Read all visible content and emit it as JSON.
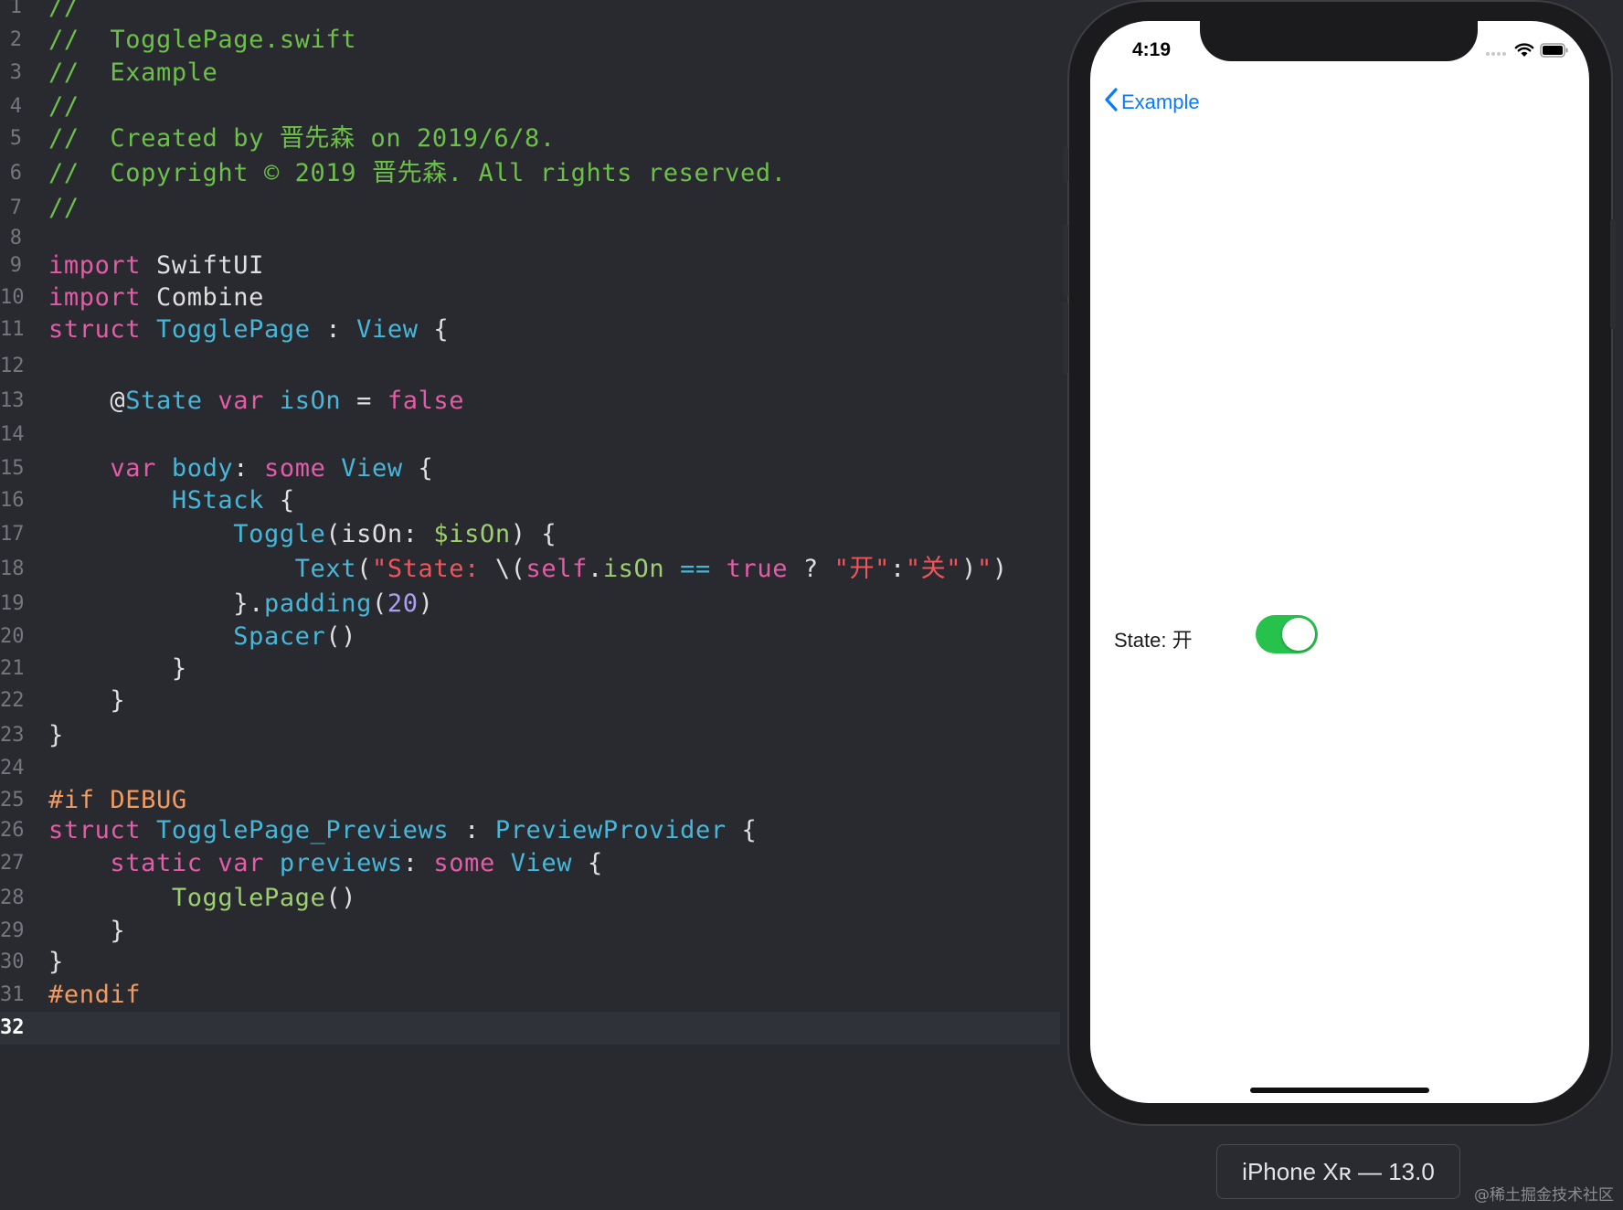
{
  "editor": {
    "current_line": 32,
    "lines": [
      {
        "n": "1",
        "tokens": [
          {
            "t": "//",
            "c": "com"
          }
        ]
      },
      {
        "n": "2",
        "tokens": [
          {
            "t": "//  TogglePage.swift",
            "c": "com"
          }
        ]
      },
      {
        "n": "3",
        "tokens": [
          {
            "t": "//  Example",
            "c": "com"
          }
        ]
      },
      {
        "n": "4",
        "tokens": [
          {
            "t": "//",
            "c": "com"
          }
        ]
      },
      {
        "n": "5",
        "tokens": [
          {
            "t": "//  Created by 晋先森 on 2019/6/8.",
            "c": "com"
          }
        ]
      },
      {
        "n": "6",
        "tokens": [
          {
            "t": "//  Copyright © 2019 晋先森. All rights reserved.",
            "c": "com"
          }
        ]
      },
      {
        "n": "7",
        "tokens": [
          {
            "t": "//",
            "c": "com"
          }
        ]
      },
      {
        "n": "8",
        "tokens": []
      },
      {
        "n": "9",
        "tokens": [
          {
            "t": "import",
            "c": "kw"
          },
          {
            "t": " SwiftUI",
            "c": "pl"
          }
        ]
      },
      {
        "n": "10",
        "tokens": [
          {
            "t": "import",
            "c": "kw"
          },
          {
            "t": " Combine",
            "c": "pl"
          }
        ]
      },
      {
        "n": "11",
        "tokens": [
          {
            "t": "struct",
            "c": "kw"
          },
          {
            "t": " ",
            "c": "pl"
          },
          {
            "t": "TogglePage",
            "c": "type"
          },
          {
            "t": " : ",
            "c": "pl"
          },
          {
            "t": "View",
            "c": "type"
          },
          {
            "t": " {",
            "c": "pl"
          }
        ]
      },
      {
        "n": "12",
        "tokens": []
      },
      {
        "n": "13",
        "tokens": [
          {
            "t": "    @",
            "c": "pl"
          },
          {
            "t": "State",
            "c": "type"
          },
          {
            "t": " ",
            "c": "pl"
          },
          {
            "t": "var",
            "c": "kw"
          },
          {
            "t": " isOn",
            "c": "type"
          },
          {
            "t": " = ",
            "c": "pl"
          },
          {
            "t": "false",
            "c": "kw"
          }
        ]
      },
      {
        "n": "14",
        "tokens": []
      },
      {
        "n": "15",
        "tokens": [
          {
            "t": "    ",
            "c": "pl"
          },
          {
            "t": "var",
            "c": "kw"
          },
          {
            "t": " body",
            "c": "type"
          },
          {
            "t": ": ",
            "c": "pl"
          },
          {
            "t": "some",
            "c": "kw"
          },
          {
            "t": " ",
            "c": "pl"
          },
          {
            "t": "View",
            "c": "type"
          },
          {
            "t": " {",
            "c": "pl"
          }
        ]
      },
      {
        "n": "16",
        "tokens": [
          {
            "t": "        ",
            "c": "pl"
          },
          {
            "t": "HStack",
            "c": "type"
          },
          {
            "t": " {",
            "c": "pl"
          }
        ]
      },
      {
        "n": "17",
        "tokens": [
          {
            "t": "            ",
            "c": "pl"
          },
          {
            "t": "Toggle",
            "c": "type"
          },
          {
            "t": "(isOn: ",
            "c": "pl"
          },
          {
            "t": "$isOn",
            "c": "pr"
          },
          {
            "t": ") {",
            "c": "pl"
          }
        ]
      },
      {
        "n": "18",
        "tokens": [
          {
            "t": "                ",
            "c": "pl"
          },
          {
            "t": "Text",
            "c": "type"
          },
          {
            "t": "(",
            "c": "pl"
          },
          {
            "t": "\"State: ",
            "c": "str"
          },
          {
            "t": "\\(",
            "c": "pl"
          },
          {
            "t": "self",
            "c": "kw"
          },
          {
            "t": ".",
            "c": "pl"
          },
          {
            "t": "isOn",
            "c": "pr"
          },
          {
            "t": " == ",
            "c": "type"
          },
          {
            "t": "true",
            "c": "kw"
          },
          {
            "t": " ? ",
            "c": "pl"
          },
          {
            "t": "\"开\"",
            "c": "str"
          },
          {
            "t": ":",
            "c": "pl"
          },
          {
            "t": "\"关\"",
            "c": "str"
          },
          {
            "t": ")",
            "c": "pl"
          },
          {
            "t": "\"",
            "c": "str"
          },
          {
            "t": ")",
            "c": "pl"
          }
        ]
      },
      {
        "n": "19",
        "tokens": [
          {
            "t": "            }.",
            "c": "pl"
          },
          {
            "t": "padding",
            "c": "type"
          },
          {
            "t": "(",
            "c": "pl"
          },
          {
            "t": "20",
            "c": "num"
          },
          {
            "t": ")",
            "c": "pl"
          }
        ]
      },
      {
        "n": "20",
        "tokens": [
          {
            "t": "            ",
            "c": "pl"
          },
          {
            "t": "Spacer",
            "c": "type"
          },
          {
            "t": "()",
            "c": "pl"
          }
        ]
      },
      {
        "n": "21",
        "tokens": [
          {
            "t": "        }",
            "c": "pl"
          }
        ]
      },
      {
        "n": "22",
        "tokens": [
          {
            "t": "    }",
            "c": "pl"
          }
        ]
      },
      {
        "n": "23",
        "tokens": [
          {
            "t": "}",
            "c": "pl"
          }
        ]
      },
      {
        "n": "24",
        "tokens": []
      },
      {
        "n": "25",
        "tokens": [
          {
            "t": "#if DEBUG",
            "c": "pp"
          }
        ]
      },
      {
        "n": "26",
        "tokens": [
          {
            "t": "struct",
            "c": "kw"
          },
          {
            "t": " ",
            "c": "pl"
          },
          {
            "t": "TogglePage_Previews",
            "c": "type"
          },
          {
            "t": " : ",
            "c": "pl"
          },
          {
            "t": "PreviewProvider",
            "c": "type"
          },
          {
            "t": " {",
            "c": "pl"
          }
        ]
      },
      {
        "n": "27",
        "tokens": [
          {
            "t": "    ",
            "c": "pl"
          },
          {
            "t": "static",
            "c": "kw"
          },
          {
            "t": " ",
            "c": "pl"
          },
          {
            "t": "var",
            "c": "kw"
          },
          {
            "t": " previews",
            "c": "type"
          },
          {
            "t": ": ",
            "c": "pl"
          },
          {
            "t": "some",
            "c": "kw"
          },
          {
            "t": " ",
            "c": "pl"
          },
          {
            "t": "View",
            "c": "type"
          },
          {
            "t": " {",
            "c": "pl"
          }
        ]
      },
      {
        "n": "28",
        "tokens": [
          {
            "t": "        ",
            "c": "pl"
          },
          {
            "t": "TogglePage",
            "c": "fn"
          },
          {
            "t": "()",
            "c": "pl"
          }
        ]
      },
      {
        "n": "29",
        "tokens": [
          {
            "t": "    }",
            "c": "pl"
          }
        ]
      },
      {
        "n": "30",
        "tokens": [
          {
            "t": "}",
            "c": "pl"
          }
        ]
      },
      {
        "n": "31",
        "tokens": [
          {
            "t": "#endif",
            "c": "pp"
          }
        ]
      },
      {
        "n": "32",
        "tokens": []
      }
    ]
  },
  "simulator": {
    "status_time": "4:19",
    "back_label": "Example",
    "toggle_label": "State: 开",
    "toggle_on": true,
    "device_label": "iPhone Xʀ — 13.0"
  },
  "watermark": "@稀土掘金技术社区",
  "colors": {
    "editor_bg": "#292a30",
    "comment": "#6cc04a",
    "keyword": "#e45ba7",
    "type": "#46b7d8",
    "string": "#f0555b",
    "toggle_on": "#27c24c",
    "link_blue": "#0a7aff"
  },
  "icons": [
    "chevron-left-icon",
    "signal-icon",
    "wifi-icon",
    "battery-icon"
  ]
}
